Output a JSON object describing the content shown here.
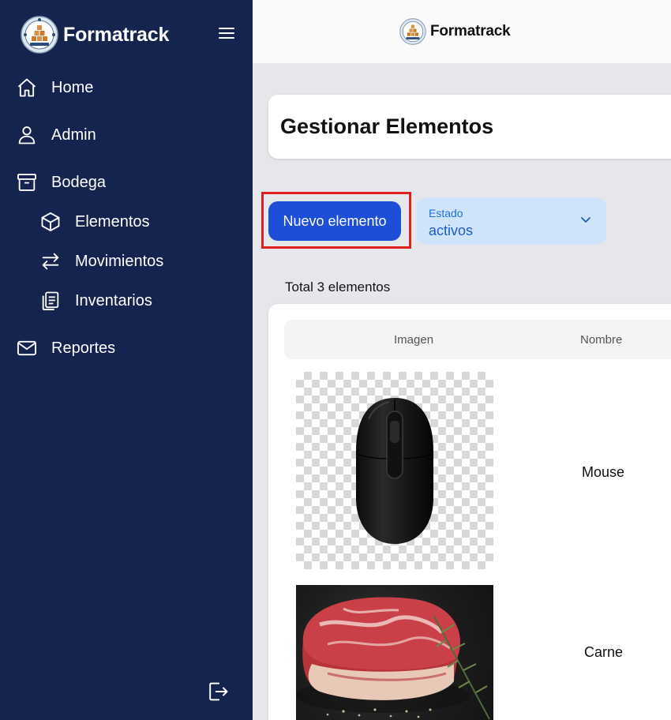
{
  "sidebar": {
    "brand": "Formatrack",
    "items": [
      {
        "label": "Home",
        "icon": "home-icon"
      },
      {
        "label": "Admin",
        "icon": "user-icon"
      },
      {
        "label": "Bodega",
        "icon": "archive-box-icon"
      },
      {
        "label": "Elementos",
        "icon": "cube-icon"
      },
      {
        "label": "Movimientos",
        "icon": "arrows-exchange-icon"
      },
      {
        "label": "Inventarios",
        "icon": "clipboard-list-icon"
      },
      {
        "label": "Reportes",
        "icon": "envelope-icon"
      }
    ]
  },
  "topbar": {
    "brand": "Formatrack"
  },
  "main": {
    "title": "Gestionar Elementos",
    "new_button": "Nuevo elemento",
    "filter": {
      "label": "Estado",
      "value": "activos"
    },
    "total": "Total 3 elementos",
    "table": {
      "columns": [
        "Imagen",
        "Nombre"
      ],
      "rows": [
        {
          "name": "Mouse",
          "image": "mouse-photo"
        },
        {
          "name": "Carne",
          "image": "meat-photo"
        }
      ]
    }
  },
  "colors": {
    "sidebar_bg": "#15244f",
    "primary": "#1d4ed8",
    "highlight": "#e01f1f",
    "select_bg": "#cfe3fb"
  }
}
